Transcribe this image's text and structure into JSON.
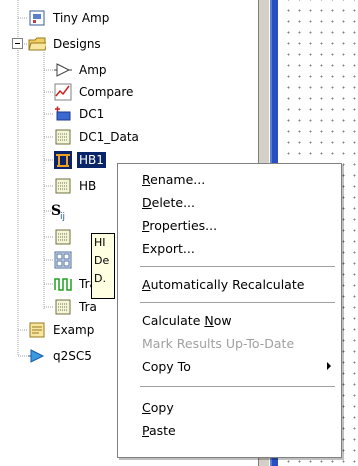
{
  "tree": {
    "items": [
      {
        "label": "Tiny Amp",
        "icon": "schematic-icon"
      },
      {
        "label": "Designs",
        "icon": "folder-open-icon"
      },
      {
        "label": "Amp",
        "icon": "amplifier-icon"
      },
      {
        "label": "Compare",
        "icon": "graph-icon"
      },
      {
        "label": "DC1",
        "icon": "dc-simulation-icon"
      },
      {
        "label": "DC1_Data",
        "icon": "data-table-icon"
      },
      {
        "label": "HB1",
        "icon": "harmonic-balance-icon"
      },
      {
        "label": "HB",
        "icon": "data-table-icon"
      },
      {
        "label": "",
        "icon": "s-parameter-icon"
      },
      {
        "label": "",
        "icon": "data-table-icon"
      },
      {
        "label": "",
        "icon": "matrix-icon"
      },
      {
        "label": "Tra",
        "icon": "transient-icon"
      },
      {
        "label": "Tra",
        "icon": "data-table-icon"
      },
      {
        "label": "Examp",
        "icon": "example-icon"
      },
      {
        "label": "q2SC5",
        "icon": "amplifier-blue-icon"
      }
    ],
    "tooltip_lines": [
      "HI",
      "De",
      "D."
    ]
  },
  "context_menu": {
    "items": [
      {
        "label": "Rename...",
        "underline": "R"
      },
      {
        "label": "Delete...",
        "underline": "D"
      },
      {
        "label": "Properties...",
        "underline": "P"
      },
      {
        "label": "Export..."
      },
      {
        "label": "Automatically Recalculate",
        "underline": "A"
      },
      {
        "label": "Calculate Now",
        "underline": "N"
      },
      {
        "label": "Mark Results Up-To-Date",
        "disabled": true
      },
      {
        "label": "Copy To",
        "submenu": true
      },
      {
        "label": "Copy",
        "underline": "C"
      },
      {
        "label": "Paste",
        "underline": "P"
      }
    ]
  },
  "colors": {
    "selection": "#0a246a",
    "menu_border": "#808080",
    "disabled_text": "#a0a0a0",
    "canvas_accent": "#2a4fc2"
  }
}
